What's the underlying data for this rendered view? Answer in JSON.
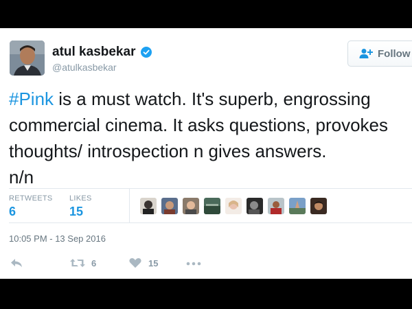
{
  "tweet": {
    "author": {
      "display_name": "atul kasbekar",
      "handle": "@atulkasbekar",
      "verified": true
    },
    "follow_label": "Follow",
    "text_lines": [
      {
        "hashtag": "#Pink",
        "rest": " is a must watch. It's superb, engrossing"
      },
      {
        "text": "commercial cinema. It asks questions, provokes"
      },
      {
        "text": "thoughts/ introspection n gives answers."
      },
      {
        "text": "n/n"
      }
    ],
    "stats": {
      "retweets_label": "RETWEETS",
      "retweets_count": "6",
      "likes_label": "LIKES",
      "likes_count": "15"
    },
    "likers_count": 9,
    "timestamp": "10:05 PM - 13 Sep 2016",
    "actions": {
      "retweet_count": "6",
      "like_count": "15"
    }
  },
  "colors": {
    "accent": "#1b95e0",
    "verified": "#1da1f2",
    "muted": "#8899a6",
    "border": "#e1e8ed"
  },
  "icons": [
    "verified-badge-icon",
    "add-user-icon",
    "reply-icon",
    "retweet-icon",
    "heart-icon",
    "more-icon"
  ]
}
